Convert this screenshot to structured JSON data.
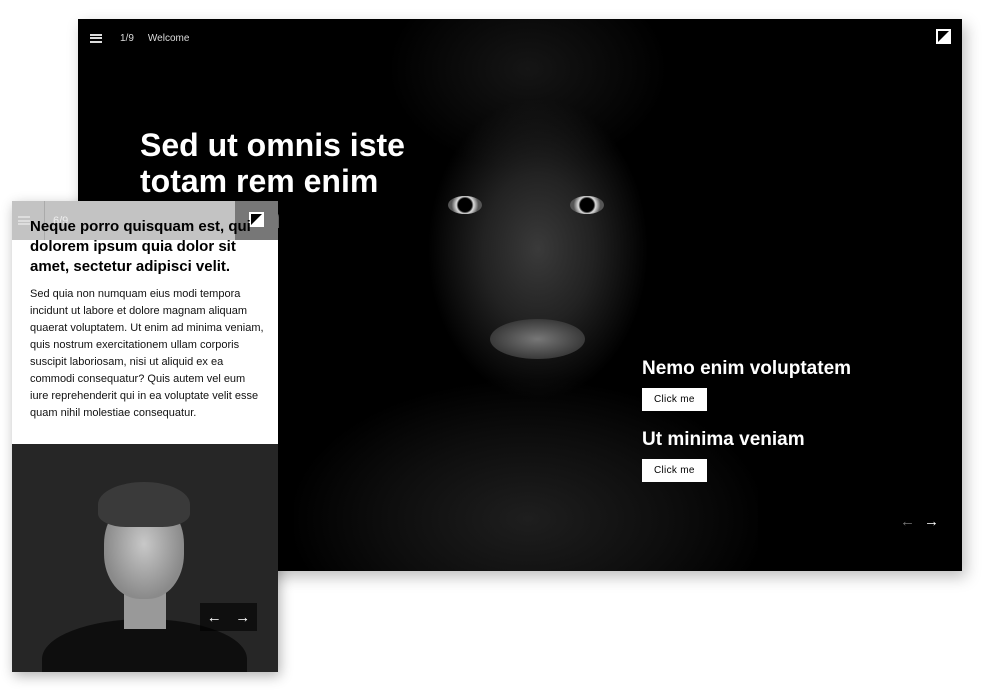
{
  "desktop": {
    "page_indicator": "1/9",
    "page_title": "Welcome",
    "hero_heading": "Sed ut omnis iste totam rem enim ventatem",
    "ctas": [
      {
        "heading": "Nemo enim voluptatem",
        "button": "Click me"
      },
      {
        "heading": "Ut minima veniam",
        "button": "Click me"
      }
    ],
    "prev_icon": "←",
    "next_icon": "→"
  },
  "mobile": {
    "page_indicator": "6/9",
    "heading": "Neque porro quisquam est, qui dolorem ipsum quia dolor sit amet, sectetur adipisci velit.",
    "body": "Sed quia non numquam eius modi tempora incidunt ut labore et dolore magnam aliquam quaerat voluptatem. Ut enim ad minima veniam, quis nostrum exercitationem ullam corporis suscipit laboriosam, nisi ut aliquid ex ea commodi consequatur? Quis autem vel eum iure reprehenderit qui in ea voluptate velit esse quam nihil molestiae consequatur.",
    "prev_icon": "←",
    "next_icon": "→"
  }
}
